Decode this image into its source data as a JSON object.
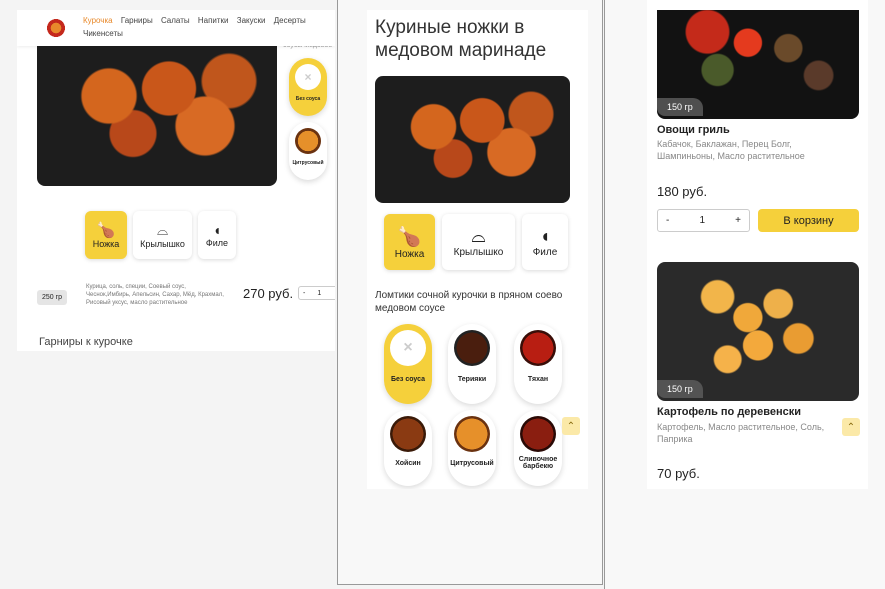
{
  "left": {
    "nav": [
      "Курочка",
      "Гарниры",
      "Салаты",
      "Напитки",
      "Закуски",
      "Десерты",
      "Чикенсеты"
    ],
    "partial_text": "соусы медовое",
    "parts": [
      {
        "label": "Ножка",
        "active": true
      },
      {
        "label": "Крылышко",
        "active": false
      },
      {
        "label": "Филе",
        "active": false
      }
    ],
    "sauces": [
      {
        "label": "Без соуса"
      },
      {
        "label": "Цитрусовый"
      }
    ],
    "weight": "250 гр",
    "ingredients": "Курица, соль, специи, Соевый соус, Чеснок,Имбирь, Апельсин, Сахар, Мёд, Крахмал, Рисовый уксус, масло растительное",
    "price": "270 руб.",
    "qty_minus": "-",
    "qty": "1",
    "section_title": "Гарниры к курочке"
  },
  "middle": {
    "title": "Куриные ножки в медовом маринаде",
    "parts": [
      {
        "label": "Ножка",
        "active": true
      },
      {
        "label": "Крылышко",
        "active": false
      },
      {
        "label": "Филе",
        "active": false
      }
    ],
    "description": "Ломтики сочной курочки в пряном соево медовом соусе",
    "sauces": [
      {
        "label": "Без соуса",
        "color": "#ffffff",
        "active": true
      },
      {
        "label": "Терияки",
        "color": "#4a1e0e",
        "active": false
      },
      {
        "label": "Тяхан",
        "color": "#b81e12",
        "active": false
      },
      {
        "label": "Хойсин",
        "color": "#7a3212",
        "active": false
      },
      {
        "label": "Цитрусовый",
        "color": "#d9820e",
        "active": false
      },
      {
        "label": "Сливочное барбекю",
        "color": "#7a1e10",
        "active": false
      }
    ]
  },
  "right": {
    "card1": {
      "weight": "150 гр",
      "name": "Овощи гриль",
      "ingredients": "Кабачок, Баклажан, Перец Болг, Шампиньоны, Масло растительное",
      "price": "180 руб.",
      "qty_minus": "-",
      "qty": "1",
      "qty_plus": "+",
      "cart": "В корзину"
    },
    "card2": {
      "weight": "150 гр",
      "name": "Картофель по деревенски",
      "ingredients": "Картофель, Масло растительное, Соль, Паприка",
      "price": "70 руб."
    }
  },
  "colors": {
    "accent": "#f5d03b",
    "nav_active": "#e8892b"
  }
}
